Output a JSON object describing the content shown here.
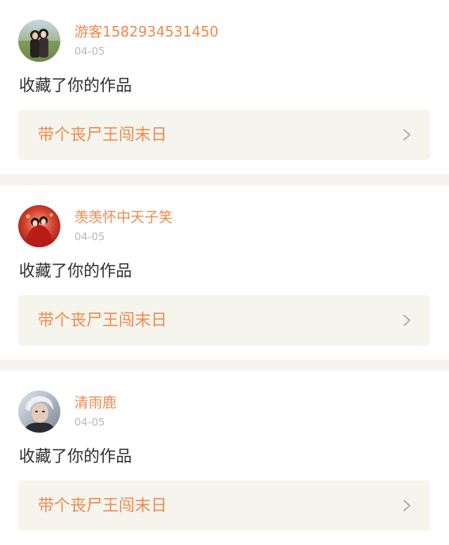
{
  "notifications": [
    {
      "username": "游客1582934531450",
      "date": "04-05",
      "action": "收藏了你的作品",
      "work_title": "带个丧尸王闯末日",
      "avatar_icon": "couple-photo-avatar"
    },
    {
      "username": "羡羡怀中天子笑",
      "date": "04-05",
      "action": "收藏了你的作品",
      "work_title": "带个丧尸王闯末日",
      "avatar_icon": "red-costume-avatar"
    },
    {
      "username": "清雨鹿",
      "date": "04-05",
      "action": "收藏了你的作品",
      "work_title": "带个丧尸王闯末日",
      "avatar_icon": "portrait-avatar"
    }
  ],
  "colors": {
    "accent": "#f0894e",
    "date_gray": "#b9b9b9",
    "text_dark": "#2f2f2f",
    "card_bg": "#f5f5ee",
    "separator": "#f6f3f2"
  }
}
